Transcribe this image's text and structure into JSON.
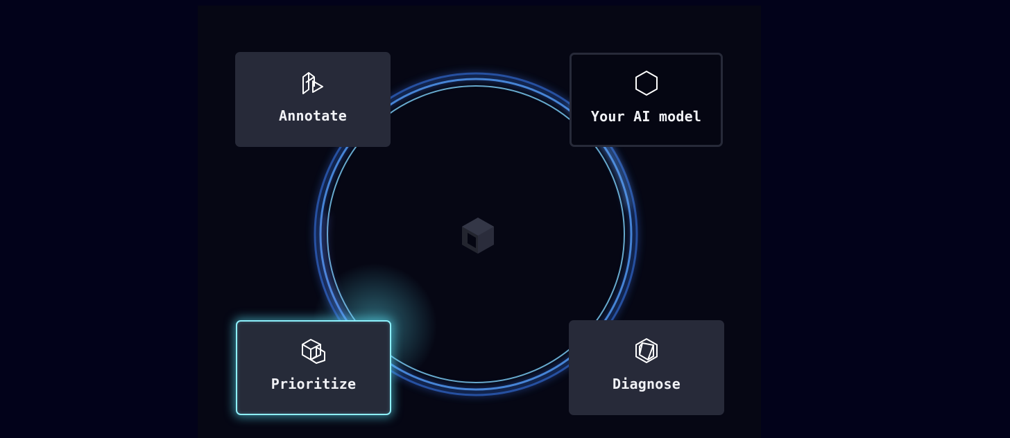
{
  "nodes": {
    "annotate": {
      "label": "Annotate",
      "icon": "annotate-icon"
    },
    "model": {
      "label": "Your AI model",
      "icon": "hexagon-icon"
    },
    "prioritize": {
      "label": "Prioritize",
      "icon": "prioritize-icon",
      "active": true
    },
    "diagnose": {
      "label": "Diagnose",
      "icon": "diagnose-icon"
    }
  },
  "center": {
    "icon": "cube-logo-icon"
  },
  "colors": {
    "background": "#02021a",
    "panel": "#060714",
    "card": "#272a39",
    "ring": "#3a78d8",
    "accent": "#8ef0fb",
    "text": "#f1f2f6"
  }
}
